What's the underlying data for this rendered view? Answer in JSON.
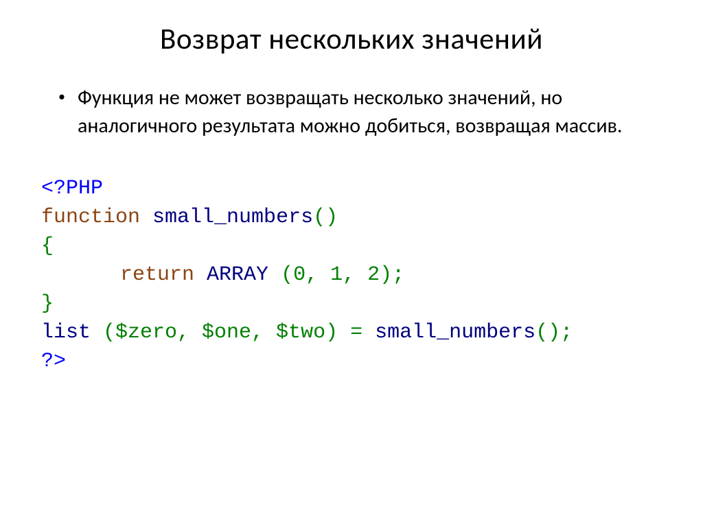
{
  "title": "Возврат нескольких значений",
  "bullet": "Функция не может возвращать несколько значений, но аналогичного результата можно добиться, возвращая массив.",
  "code": {
    "l1_open": "<?PHP",
    "l2_kw": "function",
    "l2_name": " small_numbers",
    "l2_paren": "()",
    "l3_brace": "{",
    "l4_kw": "return",
    "l4_arr": " ARRAY ",
    "l4_args": "(0, 1, 2);",
    "l5_brace": "}",
    "l6_list": "list ",
    "l6_args": "($zero, $one, $two) = ",
    "l6_call": "small_numbers",
    "l6_end": "();",
    "l7_close": "?>"
  }
}
